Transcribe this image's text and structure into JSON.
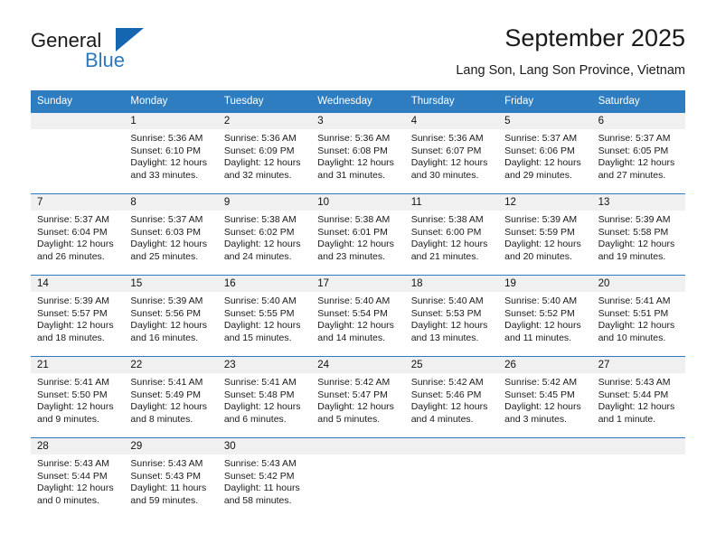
{
  "brand": {
    "name_part1": "General",
    "name_part2": "Blue",
    "triangle_icon": "triangle-icon",
    "accent_color": "#1466b0",
    "blue_text_color": "#2a7ac0"
  },
  "header": {
    "title": "September 2025",
    "subtitle": "Lang Son, Lang Son Province, Vietnam"
  },
  "calendar": {
    "header_bg": "#2e7dc0",
    "daynum_bg": "#f0f0f0",
    "weekdays": [
      "Sunday",
      "Monday",
      "Tuesday",
      "Wednesday",
      "Thursday",
      "Friday",
      "Saturday"
    ],
    "weeks": [
      [
        {
          "day": "",
          "lines": []
        },
        {
          "day": "1",
          "lines": [
            "Sunrise: 5:36 AM",
            "Sunset: 6:10 PM",
            "Daylight: 12 hours",
            "and 33 minutes."
          ]
        },
        {
          "day": "2",
          "lines": [
            "Sunrise: 5:36 AM",
            "Sunset: 6:09 PM",
            "Daylight: 12 hours",
            "and 32 minutes."
          ]
        },
        {
          "day": "3",
          "lines": [
            "Sunrise: 5:36 AM",
            "Sunset: 6:08 PM",
            "Daylight: 12 hours",
            "and 31 minutes."
          ]
        },
        {
          "day": "4",
          "lines": [
            "Sunrise: 5:36 AM",
            "Sunset: 6:07 PM",
            "Daylight: 12 hours",
            "and 30 minutes."
          ]
        },
        {
          "day": "5",
          "lines": [
            "Sunrise: 5:37 AM",
            "Sunset: 6:06 PM",
            "Daylight: 12 hours",
            "and 29 minutes."
          ]
        },
        {
          "day": "6",
          "lines": [
            "Sunrise: 5:37 AM",
            "Sunset: 6:05 PM",
            "Daylight: 12 hours",
            "and 27 minutes."
          ]
        }
      ],
      [
        {
          "day": "7",
          "lines": [
            "Sunrise: 5:37 AM",
            "Sunset: 6:04 PM",
            "Daylight: 12 hours",
            "and 26 minutes."
          ]
        },
        {
          "day": "8",
          "lines": [
            "Sunrise: 5:37 AM",
            "Sunset: 6:03 PM",
            "Daylight: 12 hours",
            "and 25 minutes."
          ]
        },
        {
          "day": "9",
          "lines": [
            "Sunrise: 5:38 AM",
            "Sunset: 6:02 PM",
            "Daylight: 12 hours",
            "and 24 minutes."
          ]
        },
        {
          "day": "10",
          "lines": [
            "Sunrise: 5:38 AM",
            "Sunset: 6:01 PM",
            "Daylight: 12 hours",
            "and 23 minutes."
          ]
        },
        {
          "day": "11",
          "lines": [
            "Sunrise: 5:38 AM",
            "Sunset: 6:00 PM",
            "Daylight: 12 hours",
            "and 21 minutes."
          ]
        },
        {
          "day": "12",
          "lines": [
            "Sunrise: 5:39 AM",
            "Sunset: 5:59 PM",
            "Daylight: 12 hours",
            "and 20 minutes."
          ]
        },
        {
          "day": "13",
          "lines": [
            "Sunrise: 5:39 AM",
            "Sunset: 5:58 PM",
            "Daylight: 12 hours",
            "and 19 minutes."
          ]
        }
      ],
      [
        {
          "day": "14",
          "lines": [
            "Sunrise: 5:39 AM",
            "Sunset: 5:57 PM",
            "Daylight: 12 hours",
            "and 18 minutes."
          ]
        },
        {
          "day": "15",
          "lines": [
            "Sunrise: 5:39 AM",
            "Sunset: 5:56 PM",
            "Daylight: 12 hours",
            "and 16 minutes."
          ]
        },
        {
          "day": "16",
          "lines": [
            "Sunrise: 5:40 AM",
            "Sunset: 5:55 PM",
            "Daylight: 12 hours",
            "and 15 minutes."
          ]
        },
        {
          "day": "17",
          "lines": [
            "Sunrise: 5:40 AM",
            "Sunset: 5:54 PM",
            "Daylight: 12 hours",
            "and 14 minutes."
          ]
        },
        {
          "day": "18",
          "lines": [
            "Sunrise: 5:40 AM",
            "Sunset: 5:53 PM",
            "Daylight: 12 hours",
            "and 13 minutes."
          ]
        },
        {
          "day": "19",
          "lines": [
            "Sunrise: 5:40 AM",
            "Sunset: 5:52 PM",
            "Daylight: 12 hours",
            "and 11 minutes."
          ]
        },
        {
          "day": "20",
          "lines": [
            "Sunrise: 5:41 AM",
            "Sunset: 5:51 PM",
            "Daylight: 12 hours",
            "and 10 minutes."
          ]
        }
      ],
      [
        {
          "day": "21",
          "lines": [
            "Sunrise: 5:41 AM",
            "Sunset: 5:50 PM",
            "Daylight: 12 hours",
            "and 9 minutes."
          ]
        },
        {
          "day": "22",
          "lines": [
            "Sunrise: 5:41 AM",
            "Sunset: 5:49 PM",
            "Daylight: 12 hours",
            "and 8 minutes."
          ]
        },
        {
          "day": "23",
          "lines": [
            "Sunrise: 5:41 AM",
            "Sunset: 5:48 PM",
            "Daylight: 12 hours",
            "and 6 minutes."
          ]
        },
        {
          "day": "24",
          "lines": [
            "Sunrise: 5:42 AM",
            "Sunset: 5:47 PM",
            "Daylight: 12 hours",
            "and 5 minutes."
          ]
        },
        {
          "day": "25",
          "lines": [
            "Sunrise: 5:42 AM",
            "Sunset: 5:46 PM",
            "Daylight: 12 hours",
            "and 4 minutes."
          ]
        },
        {
          "day": "26",
          "lines": [
            "Sunrise: 5:42 AM",
            "Sunset: 5:45 PM",
            "Daylight: 12 hours",
            "and 3 minutes."
          ]
        },
        {
          "day": "27",
          "lines": [
            "Sunrise: 5:43 AM",
            "Sunset: 5:44 PM",
            "Daylight: 12 hours",
            "and 1 minute."
          ]
        }
      ],
      [
        {
          "day": "28",
          "lines": [
            "Sunrise: 5:43 AM",
            "Sunset: 5:44 PM",
            "Daylight: 12 hours",
            "and 0 minutes."
          ]
        },
        {
          "day": "29",
          "lines": [
            "Sunrise: 5:43 AM",
            "Sunset: 5:43 PM",
            "Daylight: 11 hours",
            "and 59 minutes."
          ]
        },
        {
          "day": "30",
          "lines": [
            "Sunrise: 5:43 AM",
            "Sunset: 5:42 PM",
            "Daylight: 11 hours",
            "and 58 minutes."
          ]
        },
        {
          "day": "",
          "lines": []
        },
        {
          "day": "",
          "lines": []
        },
        {
          "day": "",
          "lines": []
        },
        {
          "day": "",
          "lines": []
        }
      ]
    ]
  }
}
